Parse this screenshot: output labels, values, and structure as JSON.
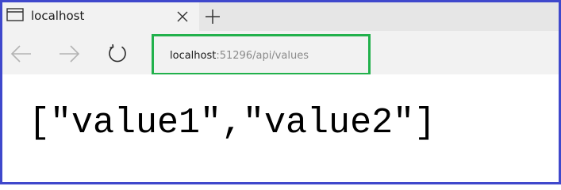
{
  "tab": {
    "title": "localhost"
  },
  "address_bar": {
    "host": "localhost",
    "path": ":51296/api/values"
  },
  "page": {
    "body_text": "[\"value1\",\"value2\"]"
  },
  "colors": {
    "frame_border": "#3f48cc",
    "address_highlight": "#22b14c"
  },
  "icons": {
    "tab": "browser-tab-icon",
    "close": "close-icon",
    "new_tab": "plus-icon",
    "back": "back-arrow-icon",
    "forward": "forward-arrow-icon",
    "refresh": "refresh-icon"
  }
}
